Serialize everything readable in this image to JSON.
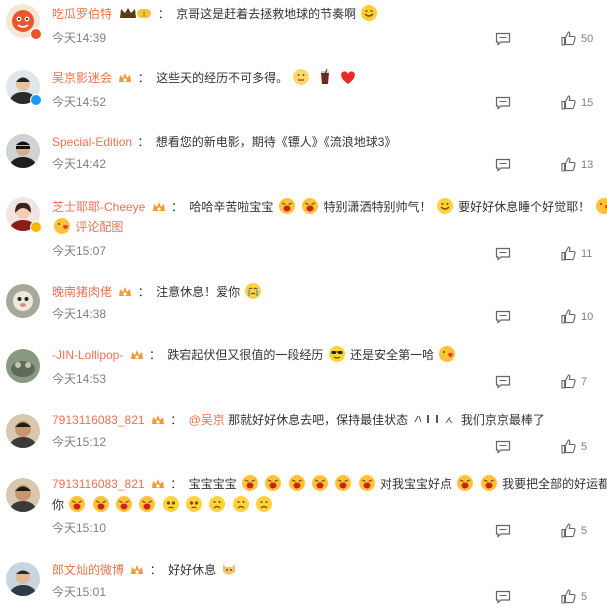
{
  "comments": [
    {
      "user": "吃瓜罗伯特",
      "text": "京哥这是赶着去拯救地球的节奏啊",
      "time": "今天14:39",
      "likes": "50",
      "badge_color": "#e8572a"
    },
    {
      "user": "吴京影迷会",
      "text": "这些天的经历不可多得。",
      "time": "今天14:52",
      "likes": "15",
      "badge_color": "#1d9bf0"
    },
    {
      "user": "Special-Edition",
      "text": "想看您的新电影，期待《镖人》《流浪地球3》",
      "time": "今天14:42",
      "likes": "13"
    },
    {
      "user": "芝士耶耶-Cheeye",
      "text_a": "哈哈辛苦啦宝宝",
      "text_b": "特别潇洒特别帅气！",
      "text_c": "要好好休息睡个好觉耶！",
      "pic_link": "评论配图",
      "time": "今天15:07",
      "likes": "11",
      "badge_color": "#f7b500"
    },
    {
      "user": "晚南猪肉佬",
      "text": "注意休息！爱你",
      "time": "今天14:38",
      "likes": "10"
    },
    {
      "user": "-JIN-Lollipop-",
      "text_a": "跌宕起伏但又很值的一段经历",
      "text_b": "还是安全第一哈",
      "time": "今天14:53",
      "likes": "7"
    },
    {
      "user": "7913116083_821",
      "mention": "@吴京",
      "text_a": "那就好好休息去吧，保持最佳状态",
      "text_b": "我们京京最棒了",
      "time": "今天15:12",
      "likes": "5"
    },
    {
      "user": "7913116083_821",
      "text_a": "宝宝宝宝",
      "text_b": "对我宝宝好点",
      "text_c": "我要把全部的好运都给",
      "text_d": "你",
      "time": "今天15:10",
      "likes": "5"
    },
    {
      "user": "郎文灿的微博",
      "text": "好好休息",
      "time": "今天15:01",
      "likes": "5"
    }
  ],
  "icons": {
    "reply": "comment-icon",
    "like": "thumbs-up-icon",
    "crown": "crown-badge-icon",
    "fan_badge": "fan-badge-icon"
  },
  "colors": {
    "username": "#eb7350",
    "text": "#333333",
    "meta": "#808080"
  }
}
